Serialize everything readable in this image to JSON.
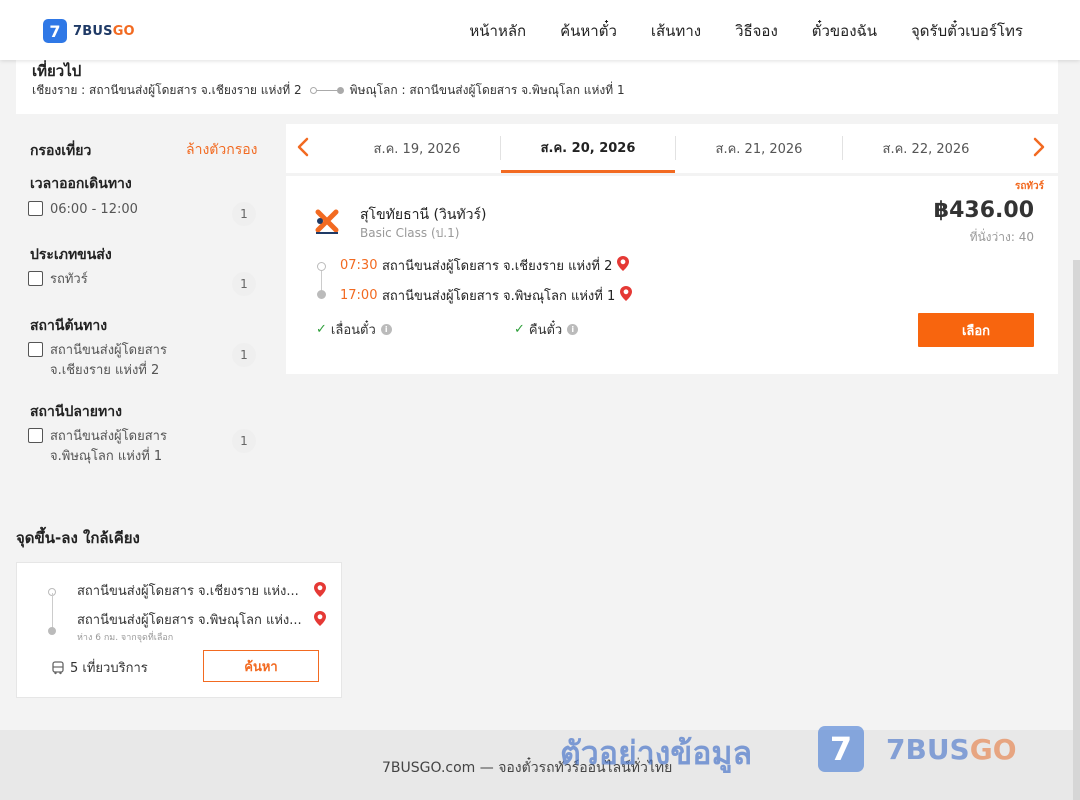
{
  "header": {
    "logo_mark": "7",
    "logo_num": "7BUS",
    "logo_go": "GO",
    "nav": [
      "หน้าหลัก",
      "ค้นหาตั๋ว",
      "เส้นทาง",
      "วิธีจอง",
      "ตั๋วของฉัน",
      "จุดรับตั๋วเบอร์โทร"
    ]
  },
  "trip": {
    "title": "เที่ยวไป",
    "origin": "เชียงราย : สถานีขนส่งผู้โดยสาร จ.เชียงราย แห่งที่ 2",
    "destination": "พิษณุโลก : สถานีขนส่งผู้โดยสาร จ.พิษณุโลก แห่งที่ 1"
  },
  "filters": {
    "title": "กรองเที่ยว",
    "clear": "ล้างตัวกรอง",
    "sections": [
      {
        "title": "เวลาออกเดินทาง",
        "option": "06:00 - 12:00",
        "count": "1"
      },
      {
        "title": "ประเภทขนส่ง",
        "option": "รถทัวร์",
        "count": "1"
      },
      {
        "title": "สถานีต้นทาง",
        "option": "สถานีขนส่งผู้โดยสาร จ.เชียงราย แห่งที่ 2",
        "count": "1"
      },
      {
        "title": "สถานีปลายทาง",
        "option": "สถานีขนส่งผู้โดยสาร จ.พิษณุโลก แห่งที่ 1",
        "count": "1"
      }
    ]
  },
  "dates": {
    "prev_icon": "chevron-left-icon",
    "next_icon": "chevron-right-icon",
    "tabs": [
      "ส.ค. 19, 2026",
      "ส.ค. 20, 2026",
      "ส.ค. 21, 2026",
      "ส.ค. 22, 2026"
    ],
    "active_index": 1
  },
  "result": {
    "tag": "รถทัวร์",
    "operator": "สุโขทัยธานี (วินทัวร์)",
    "class": "Basic Class (ป.1)",
    "price": "฿436.00",
    "seats": "ที่นั่งว่าง: 40",
    "depart_time": "07:30",
    "depart_station": "สถานีขนส่งผู้โดยสาร จ.เชียงราย แห่งที่ 2",
    "arrive_time": "17:00",
    "arrive_station": "สถานีขนส่งผู้โดยสาร จ.พิษณุโลก แห่งที่ 1",
    "feature_1": "เลื่อนตั๋ว",
    "feature_2": "คืนตั๋ว",
    "select_label": "เลือก"
  },
  "nearby": {
    "title": "จุดขึ้น-ลง ใกล้เคียง",
    "stop_1": "สถานีขนส่งผู้โดยสาร จ.เชียงราย แห่ง...",
    "stop_2": "สถานีขนส่งผู้โดยสาร จ.พิษณุโลก แห่ง...",
    "distance": "ห่าง 6 กม. จากจุดที่เลือก",
    "trips": "5 เที่ยวบริการ",
    "search_label": "ค้นหา"
  },
  "footer": {
    "text": "7BUSGO.com — จองตั๋วรถทัวร์ออนไลน์ทั่วไทย",
    "watermark": "ตัวอย่างข้อมูล",
    "wm_mark": "7",
    "wm_word_1": "7BUS",
    "wm_word_2": "GO"
  },
  "colors": {
    "accent": "#f26a21",
    "button": "#f8650e",
    "brand_blue": "#2f78e6"
  }
}
